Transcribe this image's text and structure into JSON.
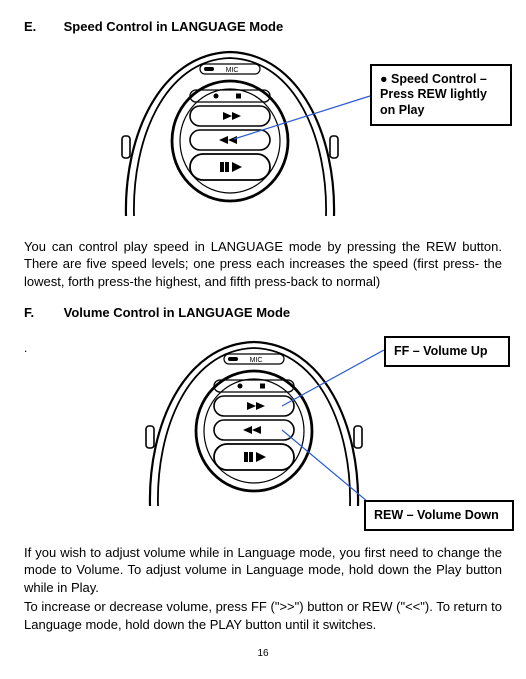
{
  "sectionE": {
    "letter": "E.",
    "title": "Speed Control in LANGUAGE Mode",
    "callout": "● Speed Control – Press REW lightly on Play",
    "paragraph": "You can control play speed in LANGUAGE mode by pressing the REW button. There are five speed levels; one press each increases the speed (first press- the lowest, forth press-the highest, and fifth press-back to normal)"
  },
  "sectionF": {
    "letter": "F.",
    "title": "Volume Control in LANGUAGE Mode",
    "callout_ff": "FF – Volume Up",
    "callout_rew": "REW – Volume Down",
    "paragraph1": "If you wish to adjust volume while in Language mode, you first need to change the mode to Volume. To adjust volume in Language mode, hold down the Play button while in Play.",
    "paragraph2": "To increase or decrease volume, press FF (\">>\") button or REW (\"<<\"). To return to Language mode, hold down the PLAY button until it switches."
  },
  "device": {
    "mic_label": "MIC"
  },
  "page_number": "16"
}
